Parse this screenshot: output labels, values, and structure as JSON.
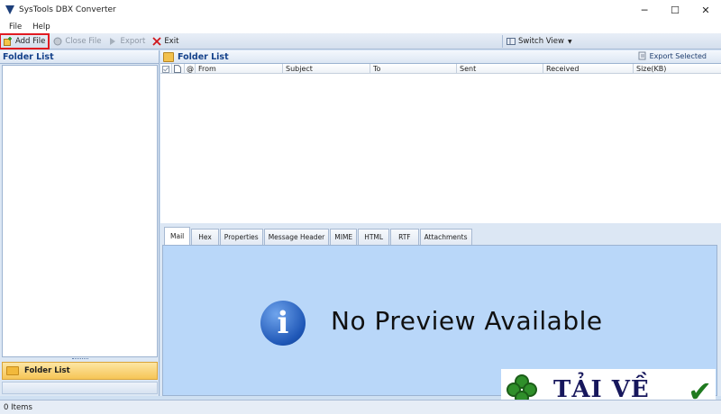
{
  "window": {
    "title": "SysTools DBX Converter",
    "minimize": "─",
    "maximize": "☐",
    "close": "✕"
  },
  "menu": [
    "File",
    "Help"
  ],
  "toolbar": {
    "add_file": "Add File",
    "close_file": "Close File",
    "export": "Export",
    "exit": "Exit",
    "switch_view": "Switch View"
  },
  "left_pane": {
    "title": "Folder List",
    "folder_button": "Folder List"
  },
  "right_pane": {
    "title": "Folder List",
    "export_selected": "Export Selected",
    "columns": [
      "From",
      "Subject",
      "To",
      "Sent",
      "Received",
      "Size(KB)"
    ]
  },
  "preview": {
    "tabs": [
      "Mail",
      "Hex",
      "Properties",
      "Message Header",
      "MIME",
      "HTML",
      "RTF",
      "Attachments"
    ],
    "active_tab": "Mail",
    "message": "No Preview Available",
    "info_glyph": "i"
  },
  "watermark": {
    "text": "TẢI VỀ"
  },
  "status": {
    "items": "0 Items"
  },
  "colors": {
    "accent": "#15428b",
    "highlight_box": "#e11b22",
    "preview_bg": "#b9d7f9"
  }
}
